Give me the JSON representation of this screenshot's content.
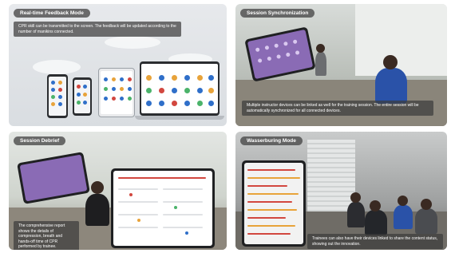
{
  "panels": [
    {
      "title": "Real-time Feedback Mode",
      "caption": "CPR skill can be transmitted to the screen. The feedback will be updated according to the number of manikins connected."
    },
    {
      "title": "Session Synchronization",
      "caption": "Multiple instructor devices can be linked as well for the training session. The entire session will be automatically synchronized for all connected devices."
    },
    {
      "title": "Session Debrief",
      "caption": "The comprehensive report shows the details of compression, breath and hands-off time of CPR performed by trainee."
    },
    {
      "title": "Wasserburing Mode",
      "caption": "Trainees can also have their devices linked to share the content status, showing out the innovation."
    }
  ],
  "colors": {
    "pill_bg": "#464646",
    "screen_purple": "#8a6bb5",
    "dot_blue": "#2f6fc9",
    "dot_orange": "#e8a33a",
    "dot_red": "#d2473f",
    "dot_green": "#4bb36a",
    "shirt_blue": "#2a52a8"
  }
}
